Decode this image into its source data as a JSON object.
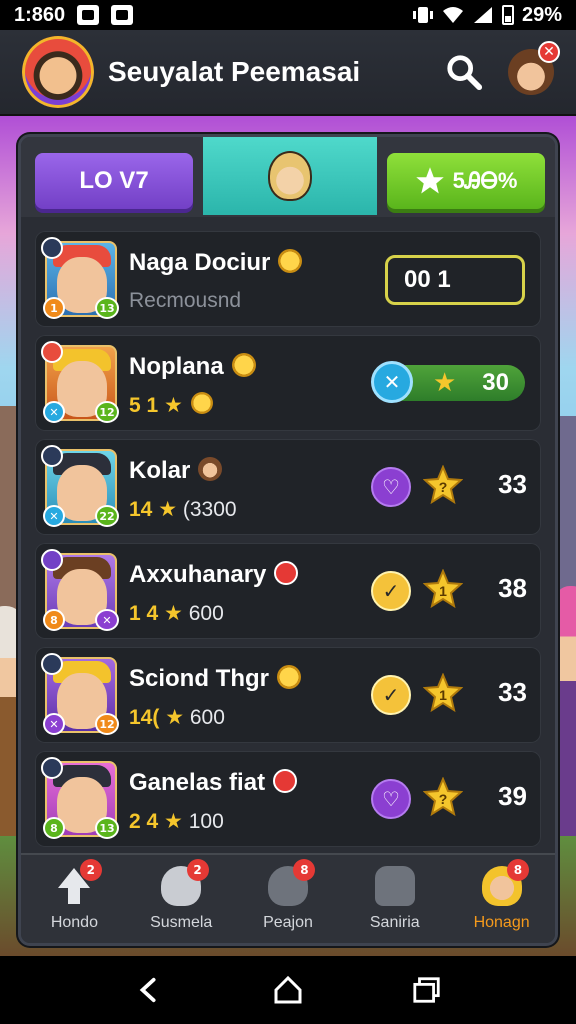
{
  "status_bar": {
    "time": "1:860",
    "battery": "29%"
  },
  "header": {
    "title": "Seuyalat Peemasai",
    "profile_badge": "✕"
  },
  "tabs": {
    "level": "LO V7",
    "stars": "5ᎯᎾ%"
  },
  "rows": [
    {
      "name": "Naga Dociur",
      "name_badge": "gold",
      "sub_text": "Recmousnd",
      "kind": "code",
      "code": "00 1"
    },
    {
      "name": "Noplana",
      "name_badge": "check",
      "sub_num": "5 1",
      "sub_star": "★",
      "kind": "pill",
      "pill_value": "30",
      "pill_icon": "✕"
    },
    {
      "name": "Kolar",
      "name_badge": "face",
      "sub_num": "14",
      "sub_star": "★",
      "sub_value": "(3300",
      "kind": "action",
      "action": "heart",
      "star_mark": "?",
      "score": "33"
    },
    {
      "name": "Axxuhanary",
      "name_badge": "red",
      "sub_num": "1 4",
      "sub_star": "★",
      "sub_value": "600",
      "kind": "action",
      "action": "check",
      "star_mark": "1",
      "score": "38"
    },
    {
      "name": "Sciond Thgr",
      "name_badge": "gold",
      "sub_num": "14(",
      "sub_star": "★",
      "sub_value": "600",
      "kind": "action",
      "action": "check",
      "star_mark": "1",
      "score": "33"
    },
    {
      "name": "Ganelas fiat",
      "name_badge": "red",
      "sub_num": "2 4",
      "sub_star": "★",
      "sub_value": "100",
      "kind": "action",
      "action": "heart",
      "star_mark": "?",
      "score": "39"
    }
  ],
  "avatar_badges": [
    {
      "bl": "1",
      "br": "13"
    },
    {
      "bl": "✕",
      "br": "12"
    },
    {
      "bl": "✕",
      "br": "22"
    },
    {
      "bl": "8",
      "br": "✕"
    },
    {
      "bl": "✕",
      "br": "12"
    },
    {
      "bl": "8",
      "br": "13"
    }
  ],
  "nav": [
    {
      "label": "Hondo",
      "badge": "2",
      "icon": "arrow-up-icon",
      "active": false
    },
    {
      "label": "Susmela",
      "badge": "2",
      "icon": "ghost-icon",
      "active": false
    },
    {
      "label": "Peajon",
      "badge": "8",
      "icon": "creature-icon",
      "active": false
    },
    {
      "label": "Saniria",
      "badge": "",
      "icon": "puzzle-icon",
      "active": false
    },
    {
      "label": "Honagn",
      "badge": "8",
      "icon": "avatar-icon",
      "active": true
    }
  ],
  "colors": {
    "level_tab": "#7340c6",
    "stars_tab": "#5ab51c",
    "mid_tab": "#2bb5ab",
    "active_nav": "#f59a1c",
    "score_star": "#f5c62c"
  }
}
